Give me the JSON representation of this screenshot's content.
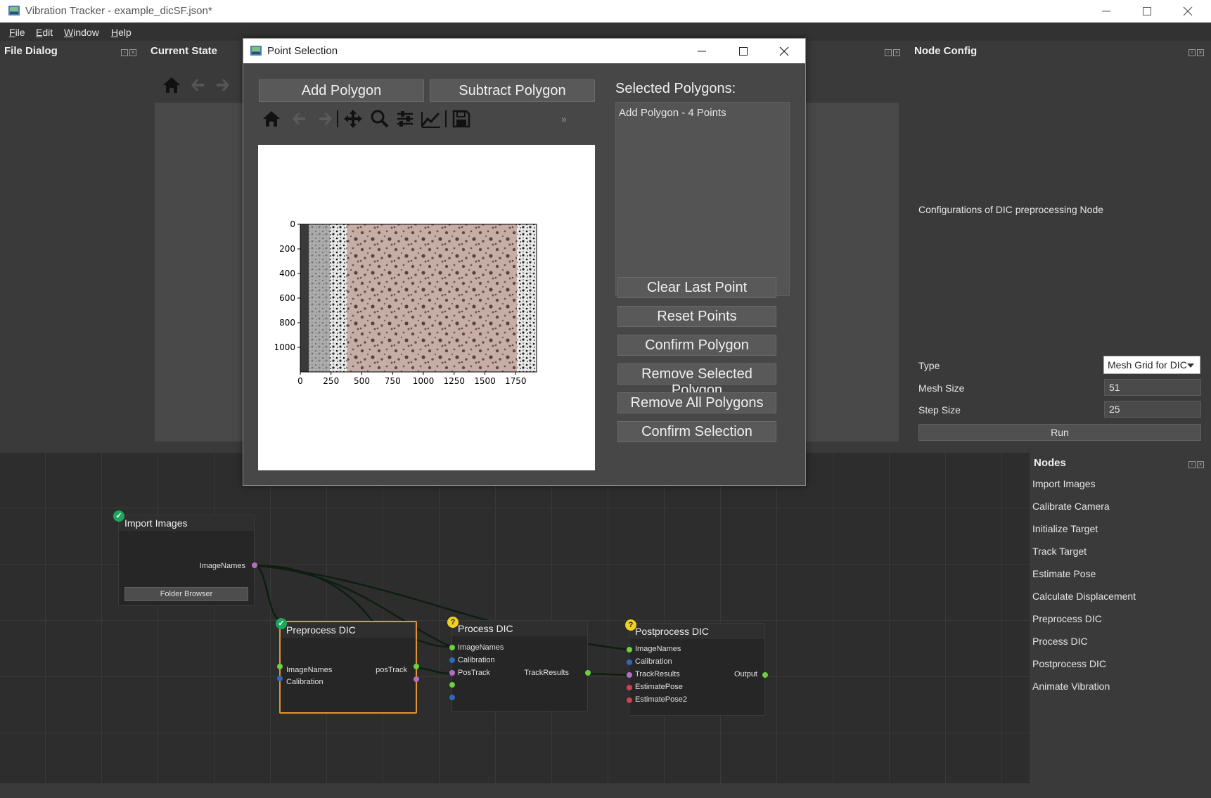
{
  "window": {
    "title": "Vibration Tracker - example_dicSF.json*"
  },
  "menu": [
    "File",
    "Edit",
    "Window",
    "Help"
  ],
  "docks": {
    "file_dialog": "File Dialog",
    "current_state": "Current State",
    "node_config": "Node Config",
    "nodes": "Nodes"
  },
  "node_config": {
    "description": "Configurations of DIC preprocessing Node",
    "type_label": "Type",
    "type_value": "Mesh Grid for DIC",
    "mesh_label": "Mesh Size",
    "mesh_value": "51",
    "step_label": "Step Size",
    "step_value": "25",
    "run_label": "Run"
  },
  "nodes_list": [
    "Import Images",
    "Calibrate Camera",
    "Initialize Target",
    "Track Target",
    "Estimate Pose",
    "Calculate Displacement",
    "Preprocess DIC",
    "Process DIC",
    "Postprocess DIC",
    "Animate Vibration"
  ],
  "graph": {
    "import": {
      "title": "Import Images",
      "out": "ImageNames",
      "button": "Folder Browser"
    },
    "pre": {
      "title": "Preprocess DIC",
      "in1": "ImageNames",
      "in2": "Calibration",
      "out": "posTrack"
    },
    "proc": {
      "title": "Process DIC",
      "in1": "ImageNames",
      "in2": "Calibration",
      "in3": "PosTrack",
      "out": "TrackResults"
    },
    "post": {
      "title": "Postprocess DIC",
      "in1": "ImageNames",
      "in2": "Calibration",
      "in3": "TrackResults",
      "in4": "EstimatePose",
      "in5": "EstimatePose2",
      "out": "Output"
    }
  },
  "dialog": {
    "title": "Point Selection",
    "add_polygon": "Add Polygon",
    "subtract_polygon": "Subtract Polygon",
    "selected_label": "Selected Polygons:",
    "polygons": [
      "Add Polygon - 4 Points"
    ],
    "clear_last": "Clear Last Point",
    "reset_points": "Reset Points",
    "confirm_polygon": "Confirm Polygon",
    "remove_selected": "Remove Selected Polygon",
    "remove_all": "Remove All Polygons",
    "confirm_selection": "Confirm Selection",
    "toolbar_overflow": "»"
  },
  "chart_data": {
    "type": "image",
    "title": "",
    "xlabel": "",
    "ylabel": "",
    "xticks": [
      "0",
      "250",
      "500",
      "750",
      "1000",
      "1250",
      "1500",
      "1750"
    ],
    "yticks": [
      "0",
      "200",
      "400",
      "600",
      "800",
      "1000"
    ],
    "xlim": [
      0,
      1920
    ],
    "ylim": [
      1200,
      0
    ],
    "polygon": [
      [
        380,
        0
      ],
      [
        1760,
        0
      ],
      [
        1760,
        1200
      ],
      [
        380,
        1200
      ]
    ],
    "polygon_color": "#c89a8e"
  }
}
